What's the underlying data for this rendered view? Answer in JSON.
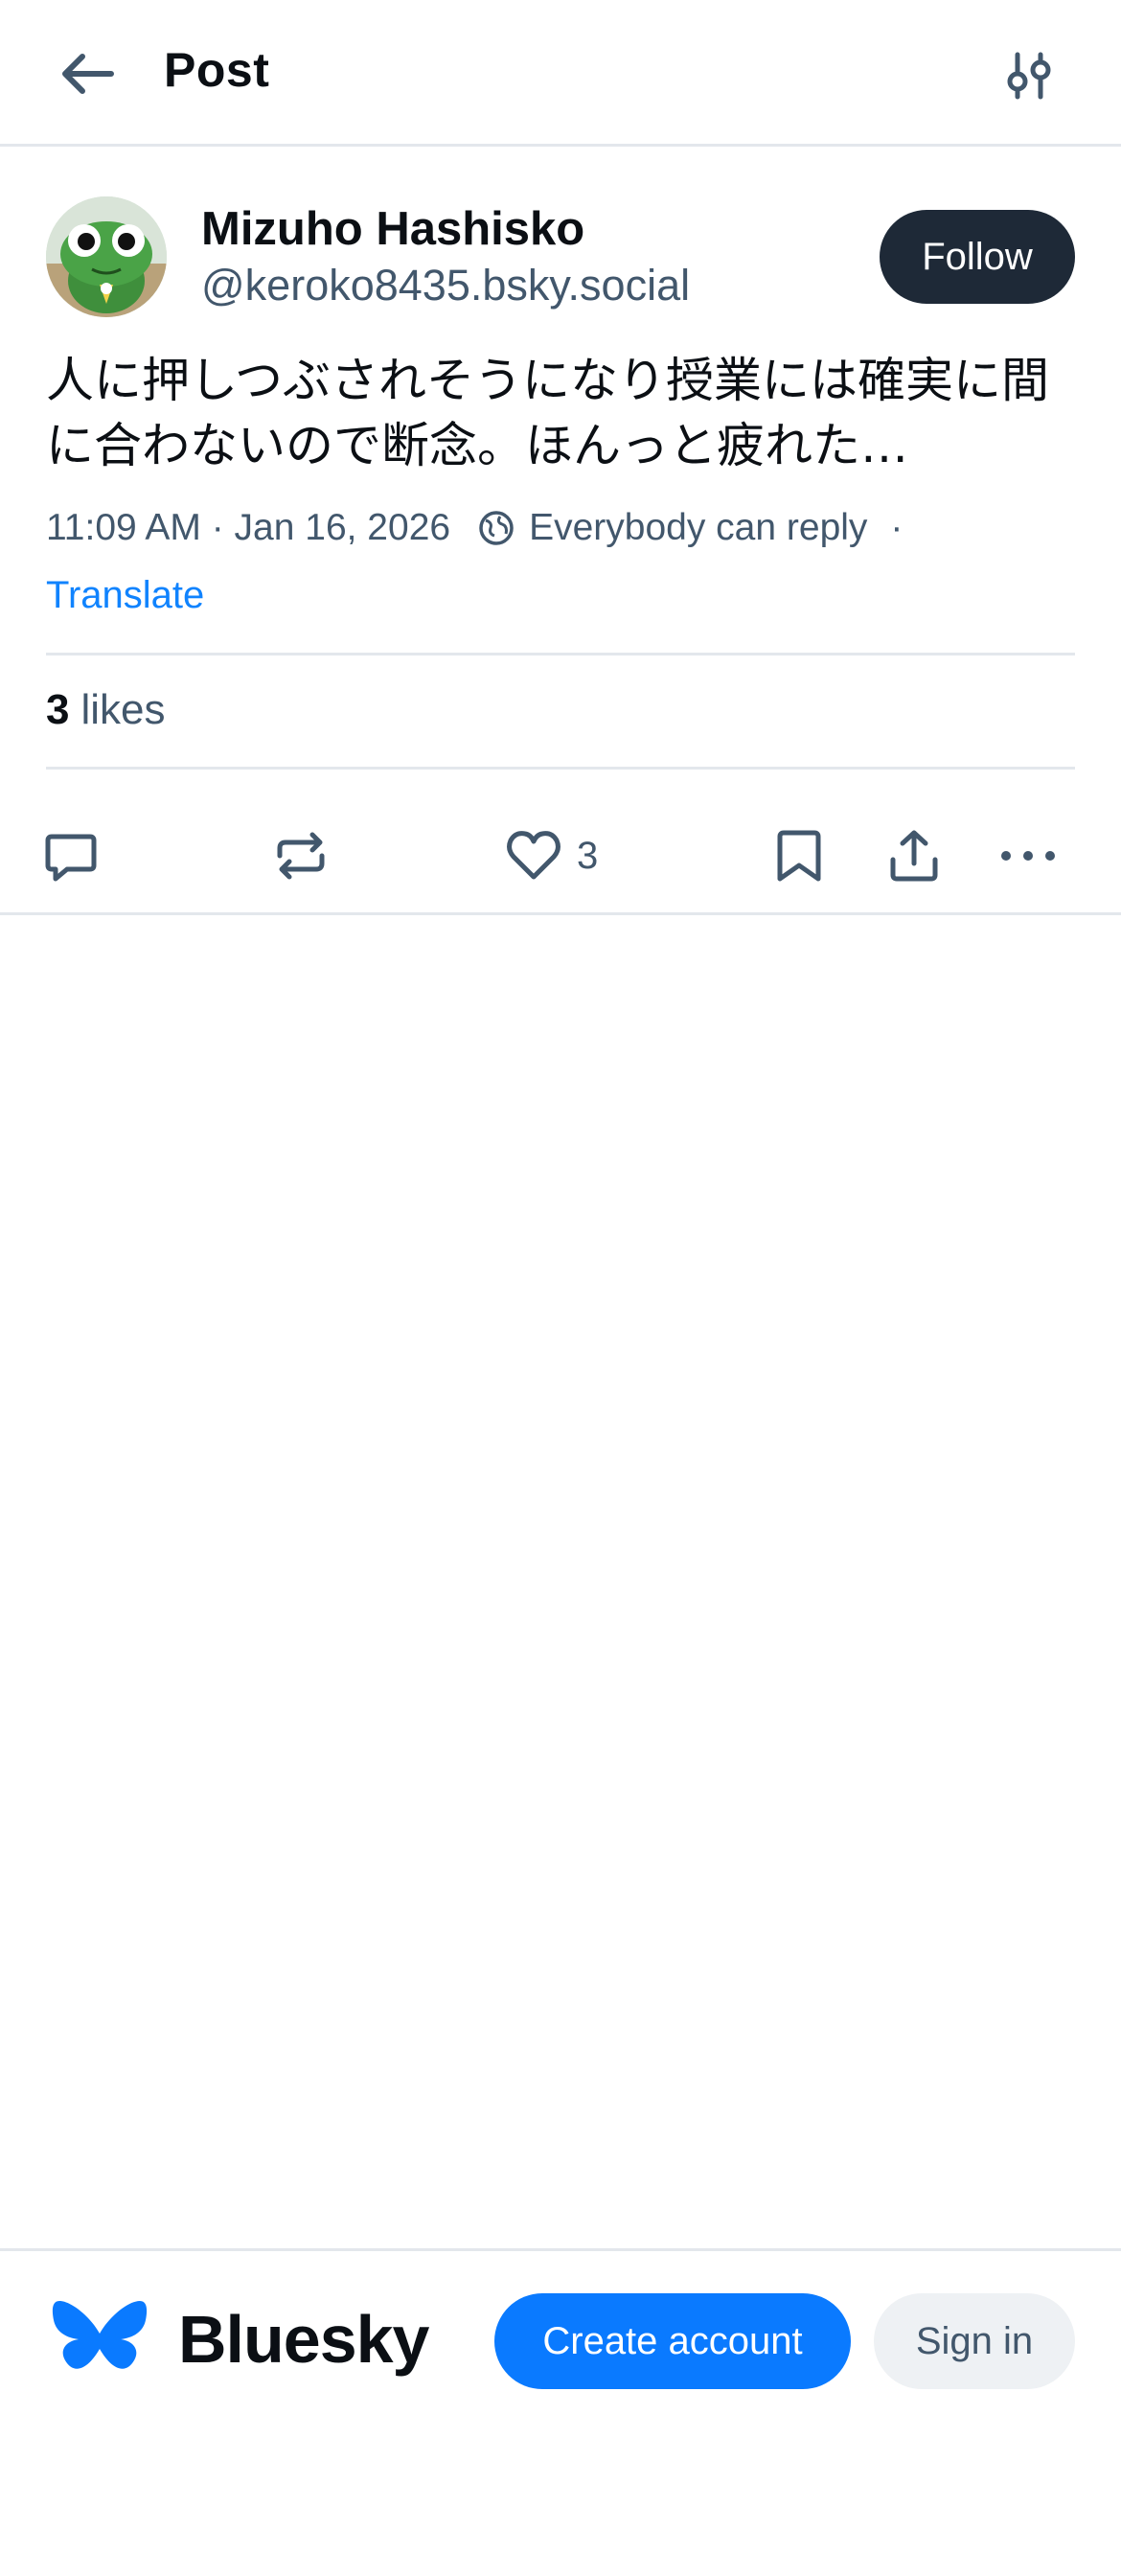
{
  "header": {
    "title": "Post",
    "back_icon": "arrow-left-icon",
    "filter_icon": "sliders-icon"
  },
  "post": {
    "author": {
      "display_name": "Mizuho Hashisko",
      "handle": "@keroko8435.bsky.social",
      "avatar_icon": "frog-avatar"
    },
    "follow_label": "Follow",
    "text_line1": "人に押しつぶされそうになり授業には確実に間",
    "text_line2": "に合わないので断念。ほんっと疲れた…",
    "timestamp": "11:09 AM · Jan 16, 2026",
    "reply_setting": "Everybody can reply",
    "separator": "·",
    "translate_label": "Translate",
    "likes_count": "3",
    "likes_label": "likes",
    "actions": {
      "reply_icon": "comment-icon",
      "repost_icon": "repost-icon",
      "like_icon": "heart-icon",
      "like_count": "3",
      "bookmark_icon": "bookmark-icon",
      "share_icon": "share-icon",
      "more_icon": "more-dots-icon"
    }
  },
  "footer": {
    "brand_name": "Bluesky",
    "create_account_label": "Create account",
    "sign_in_label": "Sign in"
  },
  "colors": {
    "accent": "#0a7aff",
    "link": "#1083fe",
    "follow_button": "#1e2937",
    "muted_text": "#42576c",
    "divider": "#e3e7ec"
  }
}
